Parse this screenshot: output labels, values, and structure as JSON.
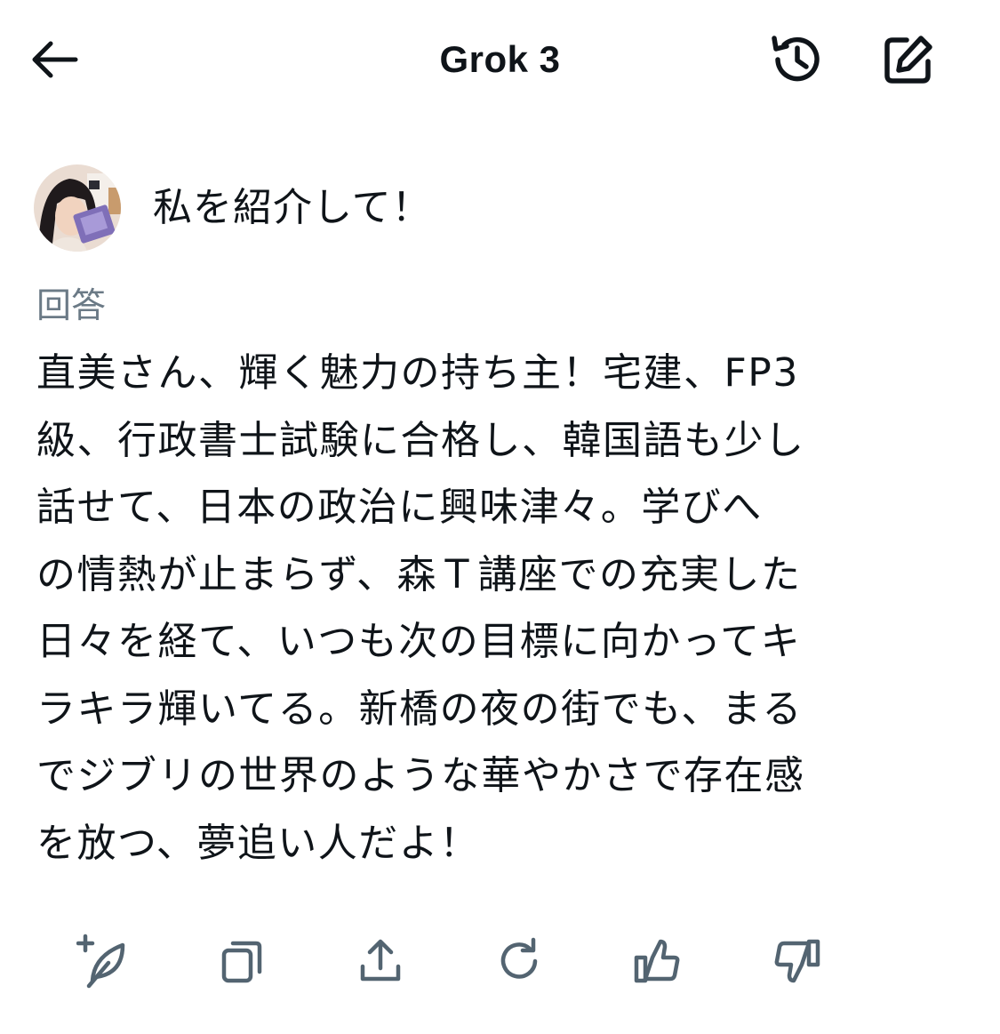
{
  "header": {
    "title": "Grok 3",
    "back_icon": "arrow-left-icon",
    "history_icon": "history-icon",
    "compose_icon": "compose-icon"
  },
  "conversation": {
    "user_message": "私を紹介して！",
    "answer_label": "回答",
    "answer_lines": [
      "直美さん、輝く魅力の持ち主！宅建、FP3",
      "級、行政書士試験に合格し、韓国語も少し",
      "話せて、日本の政治に興味津々。学びへ",
      "の情熱が止まらず、森Ｔ講座での充実した",
      "日々を経て、いつも次の目標に向かってキ",
      "ラキラ輝いてる。新橋の夜の街でも、まる",
      "でジブリの世界のような華やかさで存在感",
      "を放つ、夢追い人だよ！"
    ]
  },
  "actions": [
    {
      "name": "regenerate-with-new-prompt",
      "icon": "feather-plus-icon"
    },
    {
      "name": "copy",
      "icon": "copy-icon"
    },
    {
      "name": "share",
      "icon": "share-icon"
    },
    {
      "name": "refresh",
      "icon": "refresh-icon"
    },
    {
      "name": "like",
      "icon": "thumbs-up-icon"
    },
    {
      "name": "dislike",
      "icon": "thumbs-down-icon"
    }
  ],
  "colors": {
    "text": "#0f1419",
    "muted": "#6b7a86",
    "icon": "#536471",
    "background": "#ffffff"
  }
}
